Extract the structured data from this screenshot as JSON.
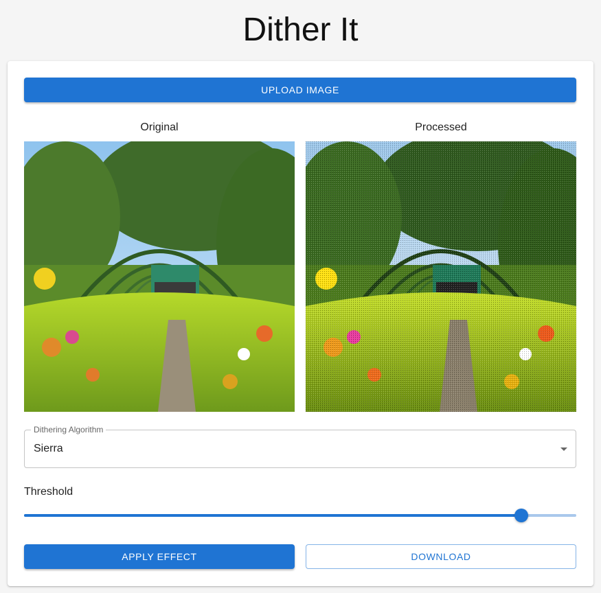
{
  "app": {
    "title": "Dither It"
  },
  "upload": {
    "label": "UPLOAD IMAGE"
  },
  "images": {
    "original_label": "Original",
    "processed_label": "Processed"
  },
  "algorithm": {
    "label": "Dithering Algorithm",
    "selected": "Sierra"
  },
  "threshold": {
    "label": "Threshold",
    "value_fraction": 0.9
  },
  "actions": {
    "apply_label": "APPLY EFFECT",
    "download_label": "DOWNLOAD"
  },
  "colors": {
    "primary": "#1f74d3",
    "rail": "#a9c8ec",
    "background": "#f5f5f5"
  },
  "icons": {
    "select_arrow": "arrow-drop-down-icon"
  }
}
